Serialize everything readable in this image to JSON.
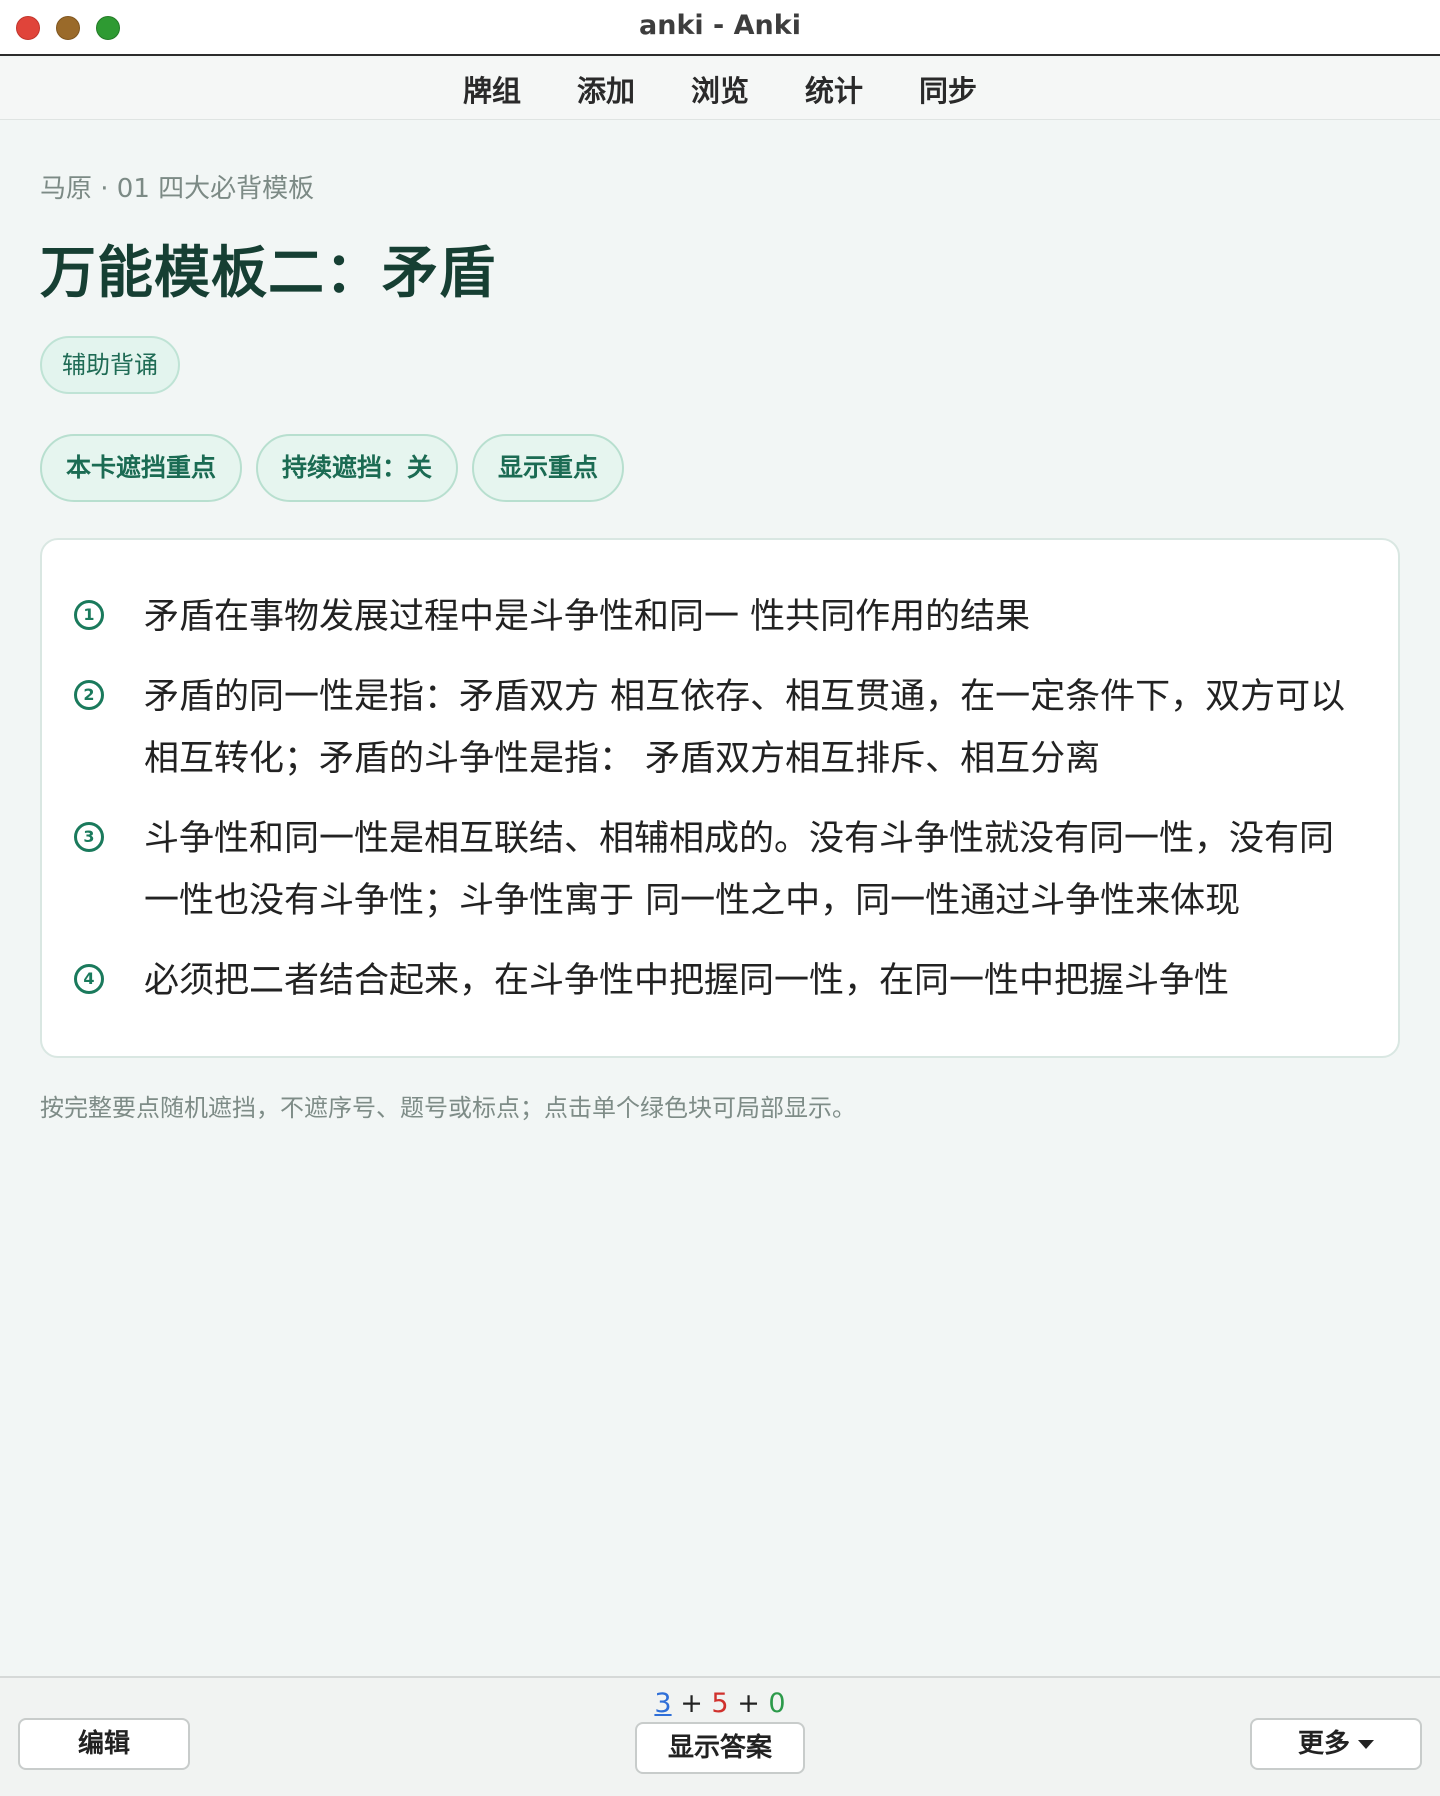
{
  "window": {
    "title": "anki - Anki"
  },
  "nav": {
    "items": [
      "牌组",
      "添加",
      "浏览",
      "统计",
      "同步"
    ]
  },
  "card": {
    "deck_path": "马原 · 01 四大必背模板",
    "title": "万能模板二：矛盾",
    "tag": "辅助背诵",
    "buttons": [
      "本卡遮挡重点",
      "持续遮挡：关",
      "显示重点"
    ],
    "points": [
      {
        "num": "1",
        "text": "矛盾在事物发展过程中是斗争性和同一 性共同作用的结果"
      },
      {
        "num": "2",
        "text": "矛盾的同一性是指：矛盾双方 相互依存、相互贯通，在一定条件下，双方可以相互转化；矛盾的斗争性是指： 矛盾双方相互排斥、相互分离"
      },
      {
        "num": "3",
        "text": "斗争性和同一性是相互联结、相辅相成的。没有斗争性就没有同一性，没有同一性也没有斗争性；斗争性寓于 同一性之中，同一性通过斗争性来体现"
      },
      {
        "num": "4",
        "text": "必须把二者结合起来，在斗争性中把握同一性，在同一性中把握斗争性"
      }
    ],
    "hint": "按完整要点随机遮挡，不遮序号、题号或标点；点击单个绿色块可局部显示。"
  },
  "bottom": {
    "counts": {
      "new": "3",
      "learn": "5",
      "due": "0",
      "sep": "+"
    },
    "edit_label": "编辑",
    "show_answer_label": "显示答案",
    "more_label": "更多"
  },
  "colors": {
    "accent": "#1a7a5c",
    "new": "#2f6fd8",
    "learn": "#d0312d",
    "due": "#2c9a4a"
  }
}
